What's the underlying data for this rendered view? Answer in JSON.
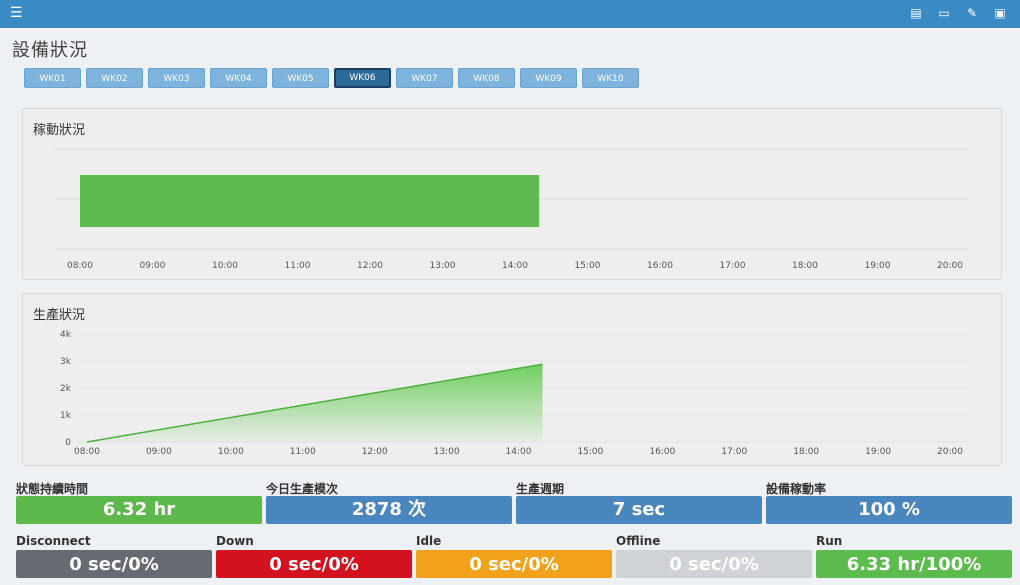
{
  "header": {
    "menu_icon": "hamburger-icon",
    "icons": [
      "monitor-list-icon",
      "display-icon",
      "edit-icon",
      "bed-icon"
    ]
  },
  "page_title": "設備狀況",
  "tabs": [
    "WK01",
    "WK02",
    "WK03",
    "WK04",
    "WK05",
    "WK06",
    "WK07",
    "WK08",
    "WK09",
    "WK10"
  ],
  "active_tab": "WK06",
  "chart_data": [
    {
      "type": "bar",
      "title": "稼動狀況",
      "x_ticks": [
        "08:00",
        "09:00",
        "10:00",
        "11:00",
        "12:00",
        "13:00",
        "14:00",
        "15:00",
        "16:00",
        "17:00",
        "18:00",
        "19:00",
        "20:00"
      ],
      "xlim": [
        "08:00",
        "20:00"
      ],
      "segments": [
        {
          "start": "08:00",
          "end": "14:20",
          "state": "Run",
          "color": "#5dbb4f"
        }
      ],
      "grid": true
    },
    {
      "type": "area",
      "title": "生產狀況",
      "x_ticks": [
        "08:00",
        "09:00",
        "10:00",
        "11:00",
        "12:00",
        "13:00",
        "14:00",
        "15:00",
        "16:00",
        "17:00",
        "18:00",
        "19:00",
        "20:00"
      ],
      "y_ticks": [
        "0",
        "1k",
        "2k",
        "3k",
        "4k"
      ],
      "ylim": [
        0,
        4000
      ],
      "xlim": [
        "08:00",
        "20:00"
      ],
      "x": [
        "08:00",
        "14:20"
      ],
      "values": [
        0,
        2878
      ],
      "color": "#6fcf5f",
      "grid": true
    }
  ],
  "stats": [
    {
      "label": "狀態持續時間",
      "value": "6.32 hr",
      "color": "#5db84c"
    },
    {
      "label": "今日生產模次",
      "value": "2878 次",
      "color": "#4a86be"
    },
    {
      "label": "生產週期",
      "value": "7 sec",
      "color": "#4a86be"
    },
    {
      "label": "設備稼動率",
      "value": "100 %",
      "color": "#4a86be"
    }
  ],
  "statuses": [
    {
      "label": "Disconnect",
      "value": "0 sec/0%",
      "color": "#666a72"
    },
    {
      "label": "Down",
      "value": "0 sec/0%",
      "color": "#d2121f"
    },
    {
      "label": "Idle",
      "value": "0 sec/0%",
      "color": "#f2a21a"
    },
    {
      "label": "Offline",
      "value": "0 sec/0%",
      "color": "#cfd2d6"
    },
    {
      "label": "Run",
      "value": "6.33 hr/100%",
      "color": "#5cbb4d"
    }
  ]
}
